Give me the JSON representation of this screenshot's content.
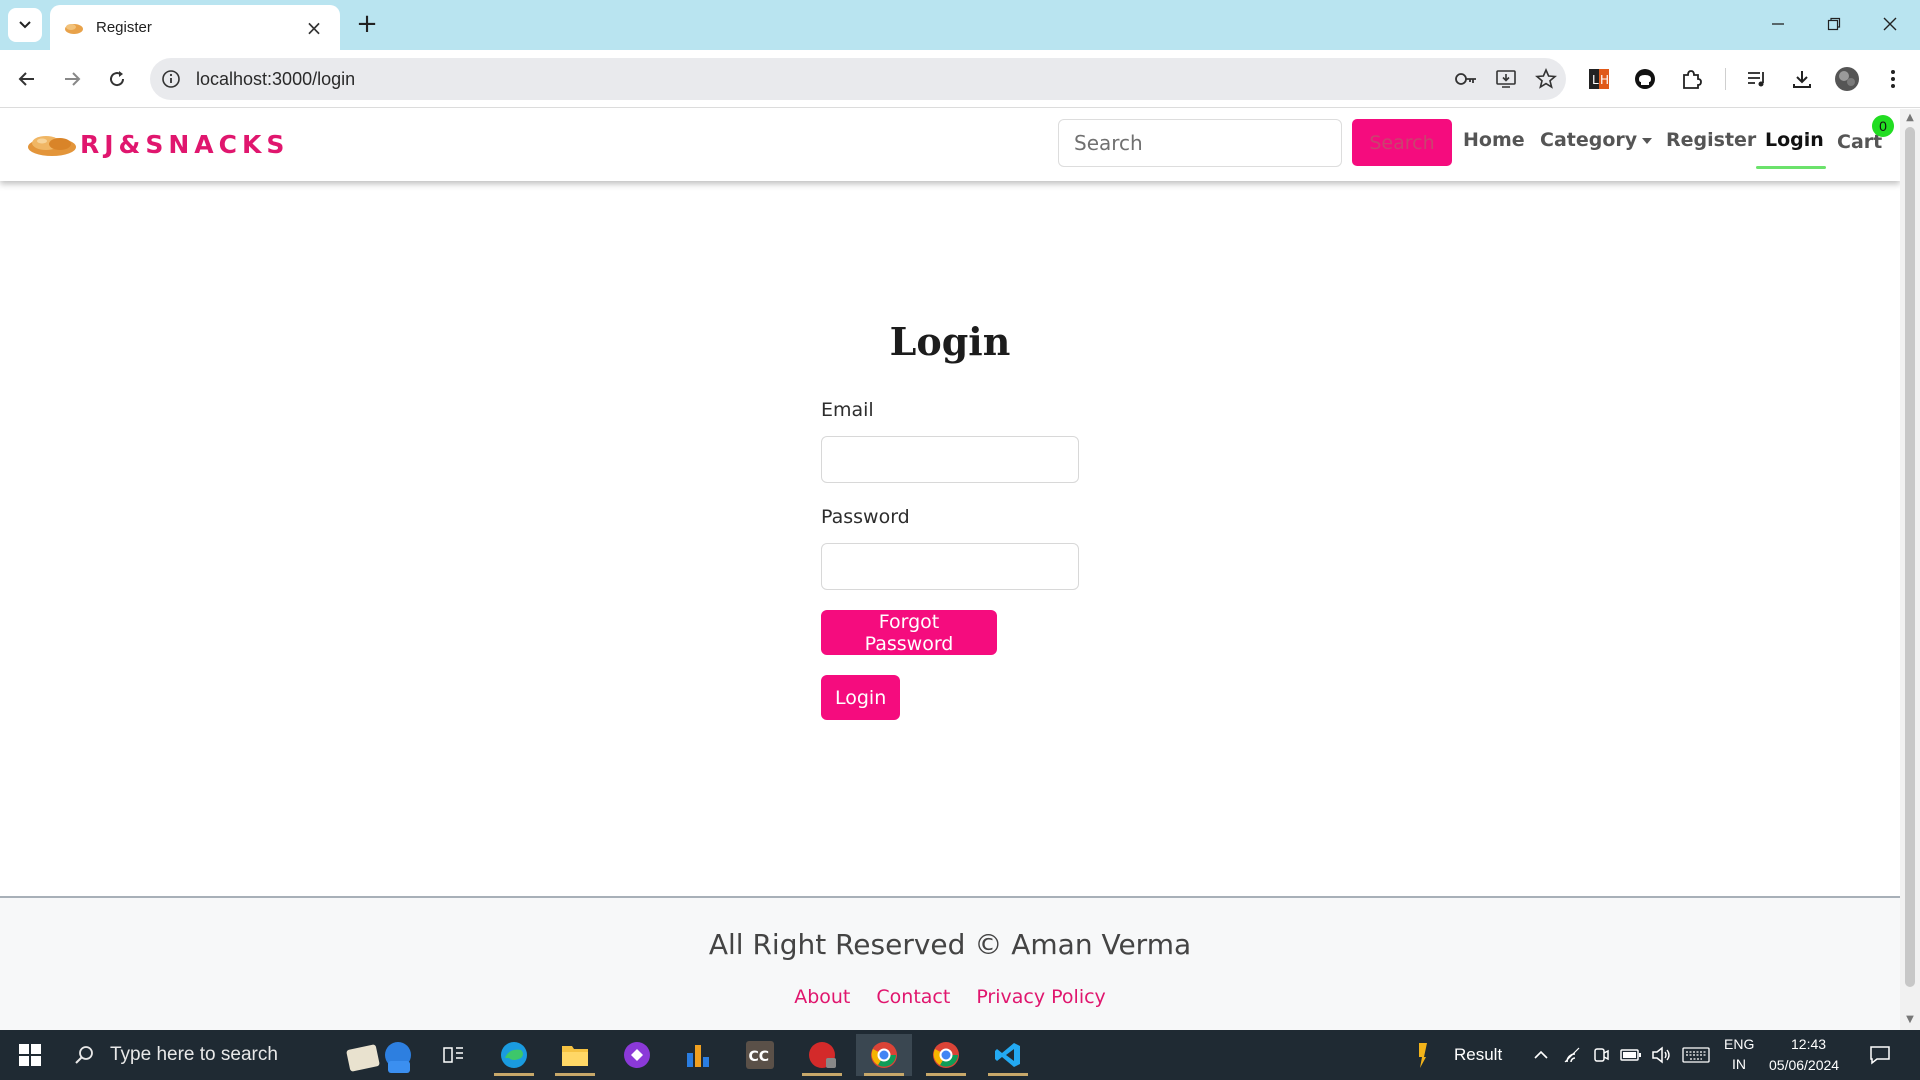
{
  "browser": {
    "tab_title": "Register",
    "url": "localhost:3000/login"
  },
  "site": {
    "brand": "RJ&SNACKS",
    "search_placeholder": "Search",
    "search_button": "Search",
    "nav": {
      "home": "Home",
      "category": "Category",
      "register": "Register",
      "login": "Login",
      "cart": "Cart",
      "cart_count": "0"
    },
    "brand_color": "#e0166e",
    "accent_color": "#f50c7e"
  },
  "login_form": {
    "title": "Login",
    "email_label": "Email",
    "email_value": "",
    "password_label": "Password",
    "password_value": "",
    "forgot_button": "Forgot Password",
    "login_button": "Login"
  },
  "footer": {
    "copyright": "All Right Reserved © Aman Verma",
    "links": [
      "About",
      "Contact",
      "Privacy Policy"
    ]
  },
  "taskbar": {
    "search_placeholder": "Type here to search",
    "weather_label": "Result",
    "language": "ENG",
    "region": "IN",
    "time": "12:43",
    "date": "05/06/2024"
  }
}
